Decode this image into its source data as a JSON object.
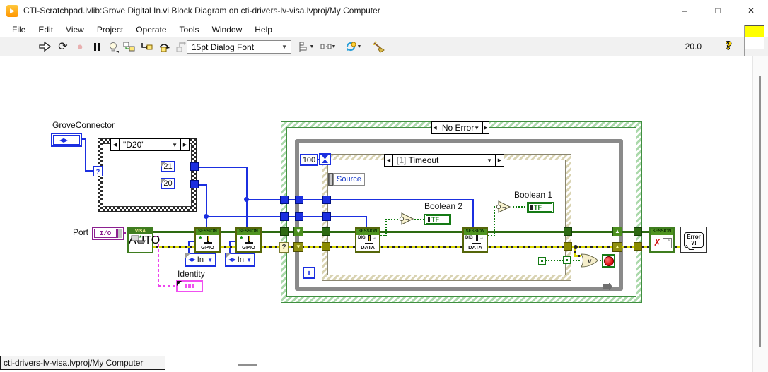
{
  "window": {
    "title": "CTI-Scratchpad.lvlib:Grove Digital In.vi Block Diagram on cti-drivers-lv-visa.lvproj/My Computer",
    "controls": {
      "minimize": "–",
      "maximize": "□",
      "close": "✕"
    },
    "app_icon_glyph": "▶"
  },
  "menu": {
    "items": [
      "File",
      "Edit",
      "View",
      "Project",
      "Operate",
      "Tools",
      "Window",
      "Help"
    ]
  },
  "toolbar": {
    "font_selector": "15pt Dialog Font",
    "zoom_level": "20.0",
    "help_glyph": "?"
  },
  "icons": {
    "dropdown": "▼",
    "left_arrow": "◀",
    "right_arrow": "▶",
    "sr_down": "▼",
    "sr_up": "▲",
    "run_continuous": "⟳",
    "abort": "●",
    "not_glyph": "¬",
    "or_glyph": "v"
  },
  "diagram": {
    "grove_connector": {
      "label": "GroveConnector"
    },
    "port": {
      "label": "Port",
      "datatype": "I/O"
    },
    "identity": {
      "label": "Identity"
    },
    "visa_open": {
      "banner": "VISA",
      "caption": "AUTO"
    },
    "case_small": {
      "selector": "\"D20\"",
      "selector_terminal": "?",
      "const_high": "21",
      "const_low": "20"
    },
    "gpio_mode_1": {
      "value": "In"
    },
    "gpio_mode_2": {
      "value": "In"
    },
    "gpio_node": {
      "banner": "SESSION",
      "property": "GPIO"
    },
    "dig_node": {
      "banner": "SESSION",
      "row1": "DIG",
      "arrow": "→",
      "property": "DATA"
    },
    "error_case": {
      "selector": "No Error",
      "selector_terminal": "?"
    },
    "while_loop": {
      "iteration": "i",
      "timeout_const": "100"
    },
    "event_structure": {
      "index": "[1]",
      "name": "Timeout",
      "data_node": "Source"
    },
    "boolean_2": {
      "label": "Boolean 2",
      "value": "TF"
    },
    "boolean_1": {
      "label": "Boolean 1",
      "value": "TF"
    },
    "close_node": {
      "banner": "SESSION"
    },
    "error_handler": {
      "line1": "Error",
      "line2": "?!"
    }
  },
  "status_bar": {
    "target": "cti-drivers-lv-visa.lvproj/My Computer"
  }
}
